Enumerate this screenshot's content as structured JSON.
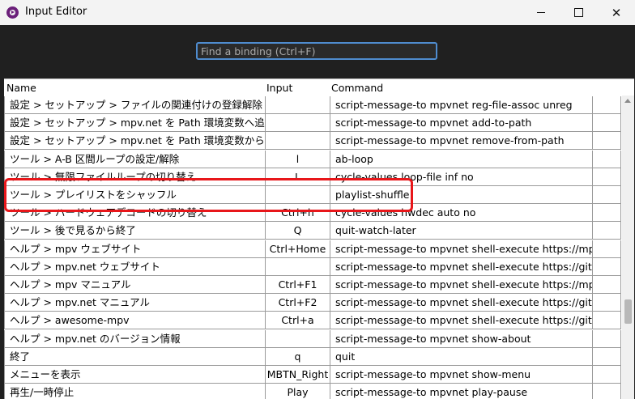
{
  "window": {
    "title": "Input Editor",
    "app_icon": "mpv-icon",
    "controls": [
      "minimize-icon",
      "maximize-icon",
      "close-icon"
    ]
  },
  "search": {
    "placeholder": "Find a binding (Ctrl+F)",
    "value": ""
  },
  "table": {
    "columns": [
      "Name",
      "Input",
      "Command"
    ],
    "rows": [
      {
        "name": "設定 > セットアップ > ファイルの関連付けの登録解除",
        "input": "",
        "command": "script-message-to mpvnet reg-file-assoc unreg"
      },
      {
        "name": "設定 > セットアップ > mpv.net を Path 環境変数へ追加",
        "input": "",
        "command": "script-message-to mpvnet add-to-path"
      },
      {
        "name": "設定 > セットアップ > mpv.net を Path 環境変数から削除",
        "input": "",
        "command": "script-message-to mpvnet remove-from-path"
      },
      {
        "name": "ツール > A-B 区間ループの設定/解除",
        "input": "l",
        "command": "ab-loop"
      },
      {
        "name": "ツール > 無限ファイルループの切り替え",
        "input": "L",
        "command": "cycle-values loop-file inf no"
      },
      {
        "name": "ツール > プレイリストをシャッフル",
        "input": "",
        "command": "playlist-shuffle"
      },
      {
        "name": "ツール > ハードウェアデコードの切り替え",
        "input": "Ctrl+h",
        "command": "cycle-values hwdec auto no"
      },
      {
        "name": "ツール > 後で見るから終了",
        "input": "Q",
        "command": "quit-watch-later"
      },
      {
        "name": "ヘルプ > mpv ウェブサイト",
        "input": "Ctrl+Home",
        "command": "script-message-to mpvnet shell-execute https://mpv.io"
      },
      {
        "name": "ヘルプ > mpv.net ウェブサイト",
        "input": "",
        "command": "script-message-to mpvnet shell-execute https://github"
      },
      {
        "name": "ヘルプ > mpv マニュアル",
        "input": "Ctrl+F1",
        "command": "script-message-to mpvnet shell-execute https://mpv.io"
      },
      {
        "name": "ヘルプ > mpv.net マニュアル",
        "input": "Ctrl+F2",
        "command": "script-message-to mpvnet shell-execute https://github"
      },
      {
        "name": "ヘルプ > awesome-mpv",
        "input": "Ctrl+a",
        "command": "script-message-to mpvnet shell-execute https://github"
      },
      {
        "name": "ヘルプ > mpv.net のバージョン情報",
        "input": "",
        "command": "script-message-to mpvnet show-about"
      },
      {
        "name": "終了",
        "input": "q",
        "command": "quit"
      },
      {
        "name": "メニューを表示",
        "input": "MBTN_Right",
        "command": "script-message-to mpvnet show-menu"
      },
      {
        "name": "再生/一時停止",
        "input": "Play",
        "command": "script-message-to mpvnet play-pause"
      }
    ],
    "highlighted_row": 5
  },
  "colors": {
    "background": "#202020",
    "search_border": "#4f8ccf",
    "highlight": "#e8161a"
  }
}
